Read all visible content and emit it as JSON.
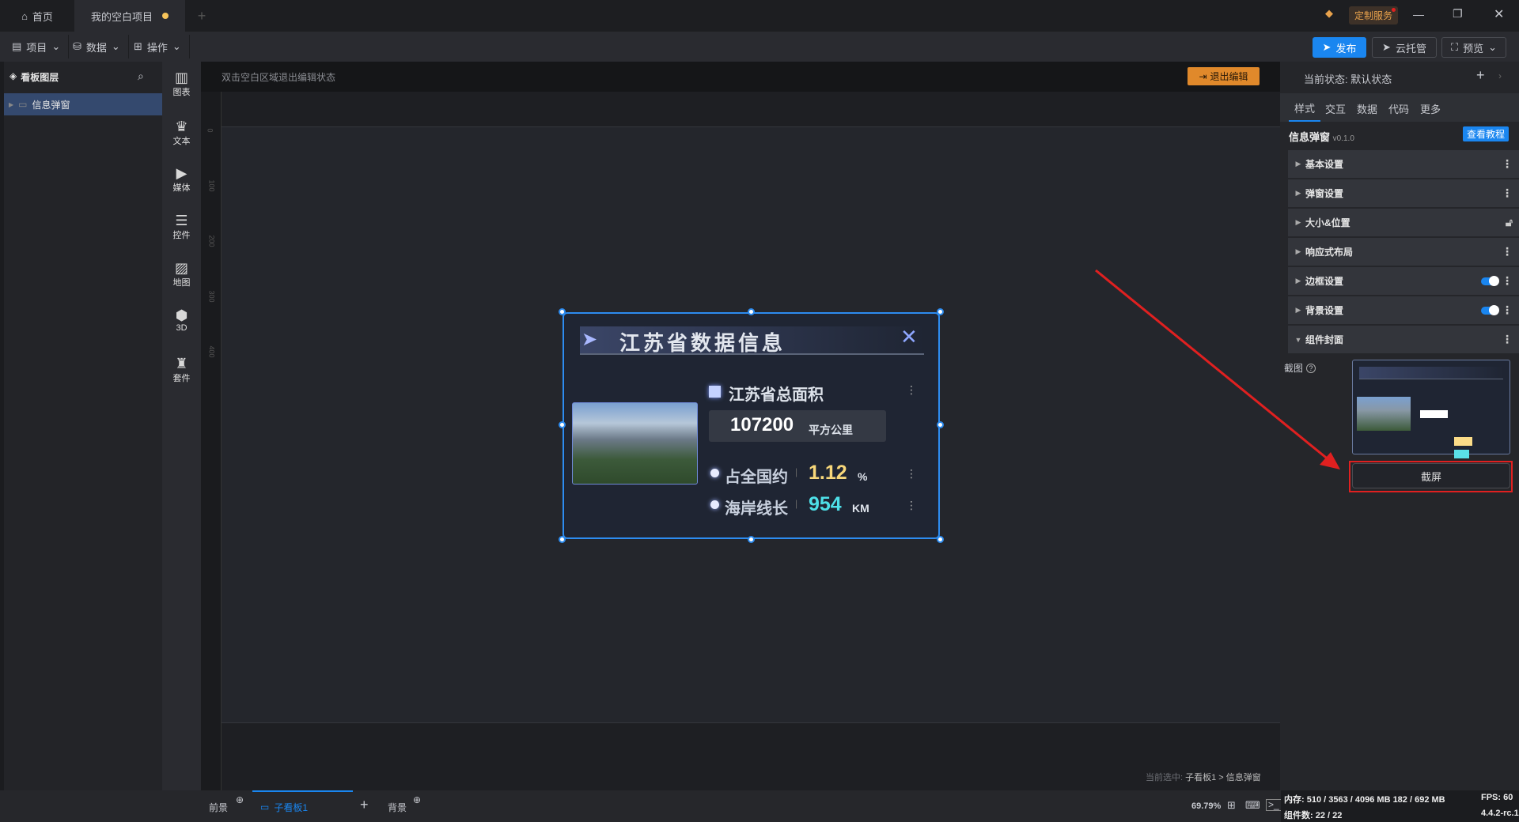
{
  "titlebar": {
    "tabs": [
      {
        "label": "首页"
      },
      {
        "label": "我的空白项目"
      }
    ],
    "new_tab": "+",
    "custom_service": "定制服务"
  },
  "menubar": {
    "menus": [
      {
        "label": "项目"
      },
      {
        "label": "数据"
      },
      {
        "label": "操作"
      }
    ],
    "publish": "发布",
    "cloud": "云托管",
    "preview": "预览"
  },
  "layers": {
    "title": "看板图层",
    "items": [
      {
        "label": "信息弹窗"
      }
    ]
  },
  "iconbar": [
    {
      "label": "图表",
      "icon": "chart-icon"
    },
    {
      "label": "文本",
      "icon": "text-icon"
    },
    {
      "label": "媒体",
      "icon": "media-icon"
    },
    {
      "label": "控件",
      "icon": "control-icon"
    },
    {
      "label": "地图",
      "icon": "map-icon"
    },
    {
      "label": "3D",
      "icon": "cube-icon"
    },
    {
      "label": "套件",
      "icon": "shirt-icon"
    }
  ],
  "canvas": {
    "hint": "双击空白区域退出编辑状态",
    "exit_edit": "退出编辑",
    "ruler": [
      "0",
      "100",
      "200",
      "300",
      "400"
    ],
    "selection_path_label": "当前选中:",
    "selection_path": "子看板1 > 信息弹窗"
  },
  "popup": {
    "title": "江苏省数据信息",
    "area_label": "江苏省总面积",
    "area_value": "107200",
    "area_unit": "平方公里",
    "share_label": "占全国约",
    "share_value": "1.12",
    "share_unit": "%",
    "coast_label": "海岸线长",
    "coast_value": "954",
    "coast_unit": "KM"
  },
  "right": {
    "state_label": "当前状态:",
    "state_value": "默认状态",
    "tabs": [
      "样式",
      "交互",
      "数据",
      "代码",
      "更多"
    ],
    "component_name": "信息弹窗",
    "version": "v0.1.0",
    "tutorial": "查看教程",
    "sections": [
      "基本设置",
      "弹窗设置",
      "大小&位置",
      "响应式布局",
      "边框设置",
      "背景设置",
      "组件封面"
    ],
    "screenshot_label": "截图",
    "screenshot_button": "截屏"
  },
  "bottom": {
    "foreground": "前景",
    "board": "子看板1",
    "background": "背景",
    "zoom": "69.79%",
    "memory": "内存: 510 / 3563 / 4096 MB  182 / 692 MB",
    "fps": "FPS: 60",
    "components": "组件数: 22 / 22",
    "version": "4.4.2-rc.1"
  },
  "colors": {
    "accent": "#1a86f0",
    "yellow": "#f7d77a",
    "cyan": "#4ee0e8",
    "annotation": "#e02020"
  }
}
